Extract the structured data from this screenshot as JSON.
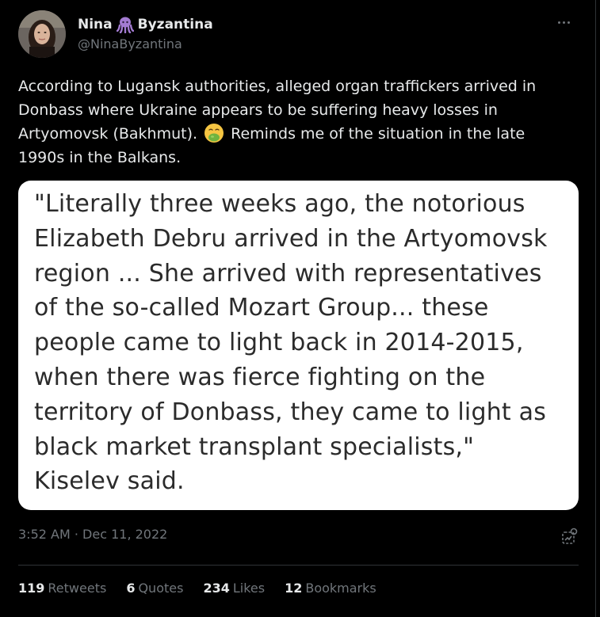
{
  "author": {
    "display_name_first": "Nina",
    "display_name_last": "Byzantina",
    "name_emoji_icon": "octopus-icon",
    "handle": "@NinaByzantina"
  },
  "tweet": {
    "text_before_emoji": "According to Lugansk authorities, alleged organ traffickers arrived in Donbass where Ukraine appears to be suffering heavy losses in Artyomovsk (Bakhmut).",
    "emoji_icon": "nauseated-face-icon",
    "text_after_emoji": "Reminds me of the situation in the late 1990s in the Balkans.",
    "image_text": "\"Literally three weeks ago, the notorious\nElizabeth Debru arrived in the Artyomovsk\nregion ... She arrived with representatives\nof the so-called Mozart Group... these\npeople came to light back in 2014-2015,\nwhen there was fierce fighting on the\nterritory of Donbass, they came to light as\nblack market transplant specialists,\"\nKiselev said."
  },
  "meta": {
    "time": "3:52 AM",
    "separator": "·",
    "date": "Dec 11, 2022"
  },
  "stats": {
    "retweets_count": "119",
    "retweets_label": "Retweets",
    "quotes_count": "6",
    "quotes_label": "Quotes",
    "likes_count": "234",
    "likes_label": "Likes",
    "bookmarks_count": "12",
    "bookmarks_label": "Bookmarks"
  },
  "colors": {
    "background": "#000000",
    "primary_text": "#e7e9ea",
    "secondary_text": "#71767b",
    "divider": "#2f3336",
    "octopus": "#a37bd1",
    "emoji_face": "#f5c542",
    "emoji_vomit": "#6fb33f"
  }
}
